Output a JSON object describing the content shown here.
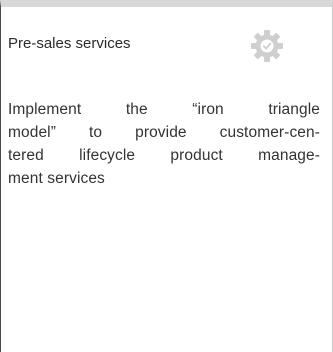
{
  "card": {
    "title": "Pre-sales services",
    "icon": "gear-check-icon",
    "icon_color": "#cfcfcf",
    "body_lines": [
      "Implement the “iron triangle",
      "model” to provide customer-cen-",
      "tered lifecycle product manage-",
      "ment services"
    ]
  }
}
